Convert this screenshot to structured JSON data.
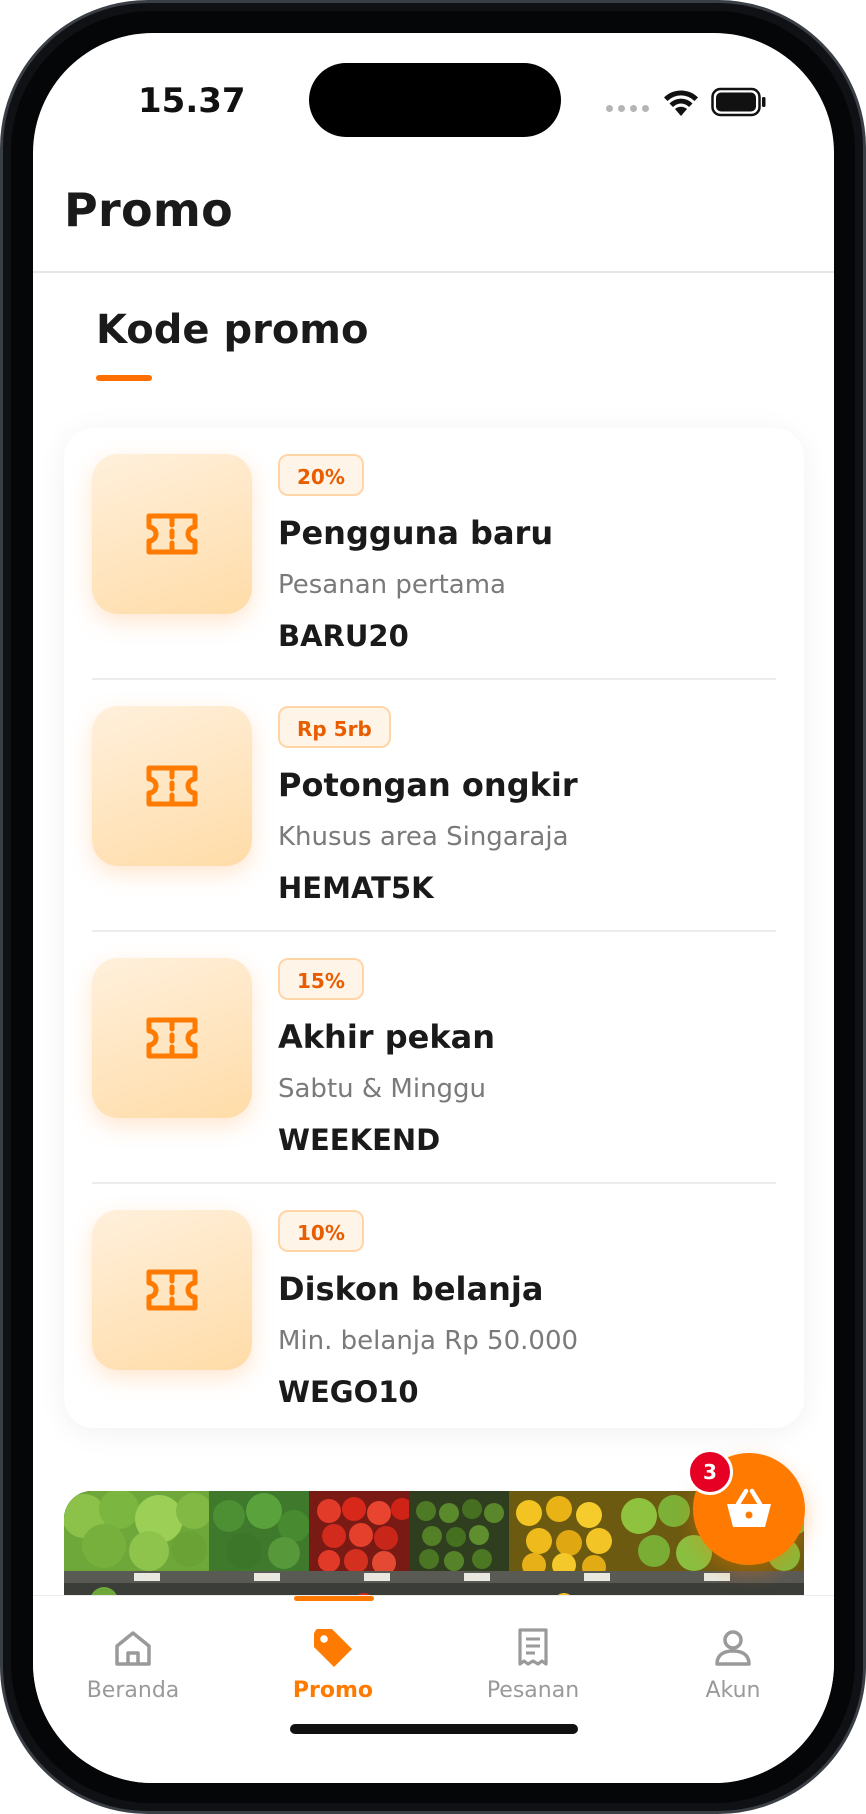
{
  "status_bar": {
    "time": "15.37"
  },
  "header": {
    "title": "Promo"
  },
  "section": {
    "title": "Kode promo"
  },
  "promos": [
    {
      "badge": "20%",
      "title": "Pengguna baru",
      "subtitle": "Pesanan pertama",
      "code": "BARU20",
      "icon": "ticket-icon"
    },
    {
      "badge": "Rp 5rb",
      "title": "Potongan ongkir",
      "subtitle": "Khusus area Singaraja",
      "code": "HEMAT5K",
      "icon": "ticket-icon"
    },
    {
      "badge": "15%",
      "title": "Akhir pekan",
      "subtitle": "Sabtu & Minggu",
      "code": "WEEKEND",
      "icon": "ticket-icon"
    },
    {
      "badge": "10%",
      "title": "Diskon belanja",
      "subtitle": "Min. belanja Rp 50.000",
      "code": "WEGO10",
      "icon": "ticket-icon"
    }
  ],
  "cart": {
    "count": "3",
    "icon": "basket-icon"
  },
  "nav": {
    "items": [
      {
        "label": "Beranda",
        "icon": "home-icon",
        "active": false
      },
      {
        "label": "Promo",
        "icon": "tag-icon",
        "active": true
      },
      {
        "label": "Pesanan",
        "icon": "receipt-icon",
        "active": false
      },
      {
        "label": "Akun",
        "icon": "user-icon",
        "active": false
      }
    ]
  },
  "colors": {
    "accent": "#ff7a00",
    "badge_bg": "#fff4e8",
    "danger": "#e60023"
  }
}
